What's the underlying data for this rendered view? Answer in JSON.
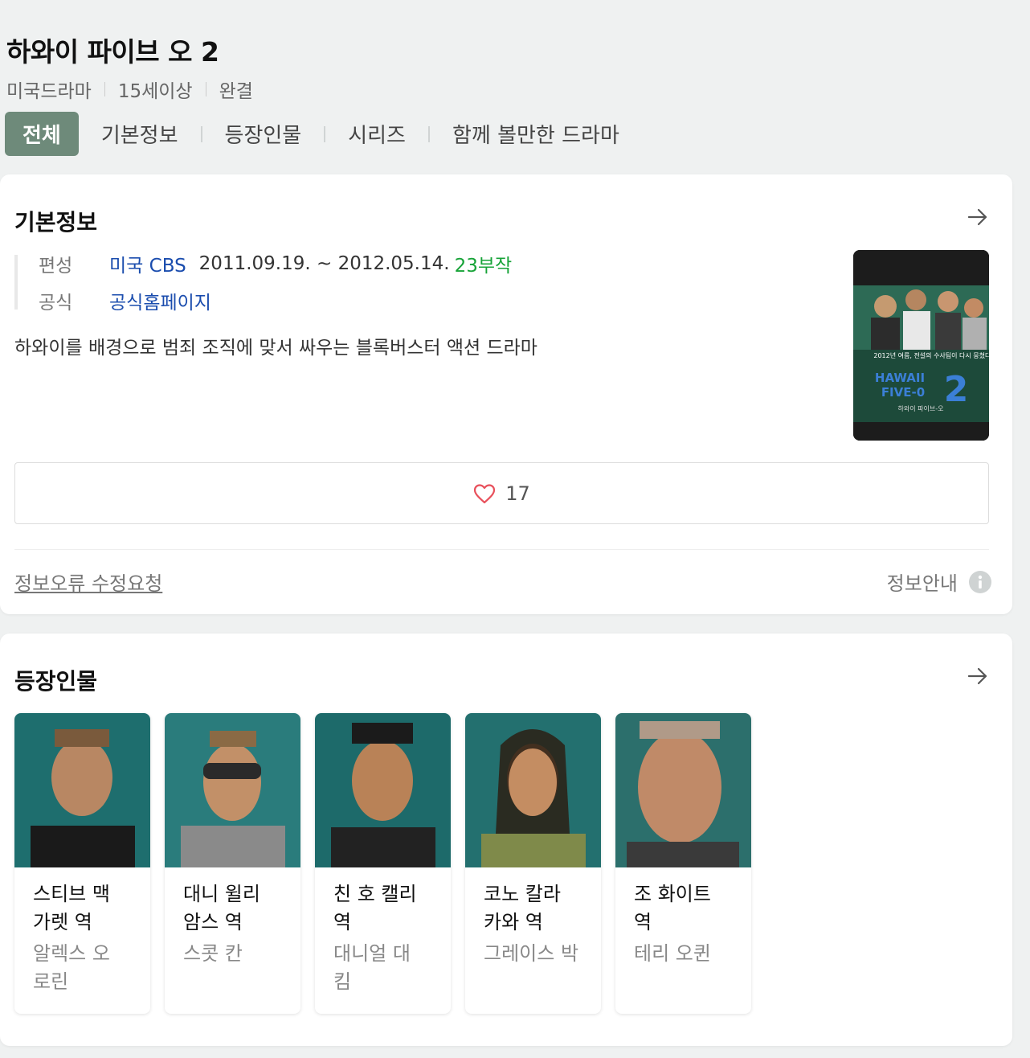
{
  "header": {
    "title": "하와이 파이브 오 2",
    "meta": [
      "미국드라마",
      "15세이상",
      "완결"
    ],
    "tabs": [
      "전체",
      "기본정보",
      "등장인물",
      "시리즈",
      "함께 볼만한 드라마"
    ],
    "active_tab": "전체"
  },
  "info": {
    "title": "기본정보",
    "rows": {
      "broadcast_label": "편성",
      "broadcaster": "미국 CBS",
      "date": "2011.09.19. ~ 2012.05.14.",
      "episodes": "23부작",
      "official_label": "공식",
      "homepage": "공식홈페이지"
    },
    "description": "하와이를 배경으로 범죄 조직에 맞서 싸우는 블록버스터 액션 드라마",
    "poster_text": {
      "top": "2012년 여름, 전설의 수사팀이 다시 뭉쳤다!",
      "logo1": "HAWAII",
      "logo2": "FIVE-0",
      "season": "2",
      "sub": "하와이 파이브-오"
    },
    "like_count": "17",
    "report_link": "정보오류 수정요청",
    "guide_link": "정보안내"
  },
  "cast": {
    "title": "등장인물",
    "members": [
      {
        "role": "스티브 맥 가렛 역",
        "actor": "알렉스 오 로린"
      },
      {
        "role": "대니 윌리 암스 역",
        "actor": "스콧 칸"
      },
      {
        "role": "친 호 캘리 역",
        "actor": "대니얼 대 킴"
      },
      {
        "role": "코노 칼라 카와 역",
        "actor": "그레이스 박"
      },
      {
        "role": "조 화이트 역",
        "actor": "테리 오퀸"
      }
    ]
  },
  "colors": {
    "active_tab_bg": "#6e8a7a",
    "link": "#1b4dae",
    "episodes": "#17a338",
    "heart": "#e8505b"
  }
}
